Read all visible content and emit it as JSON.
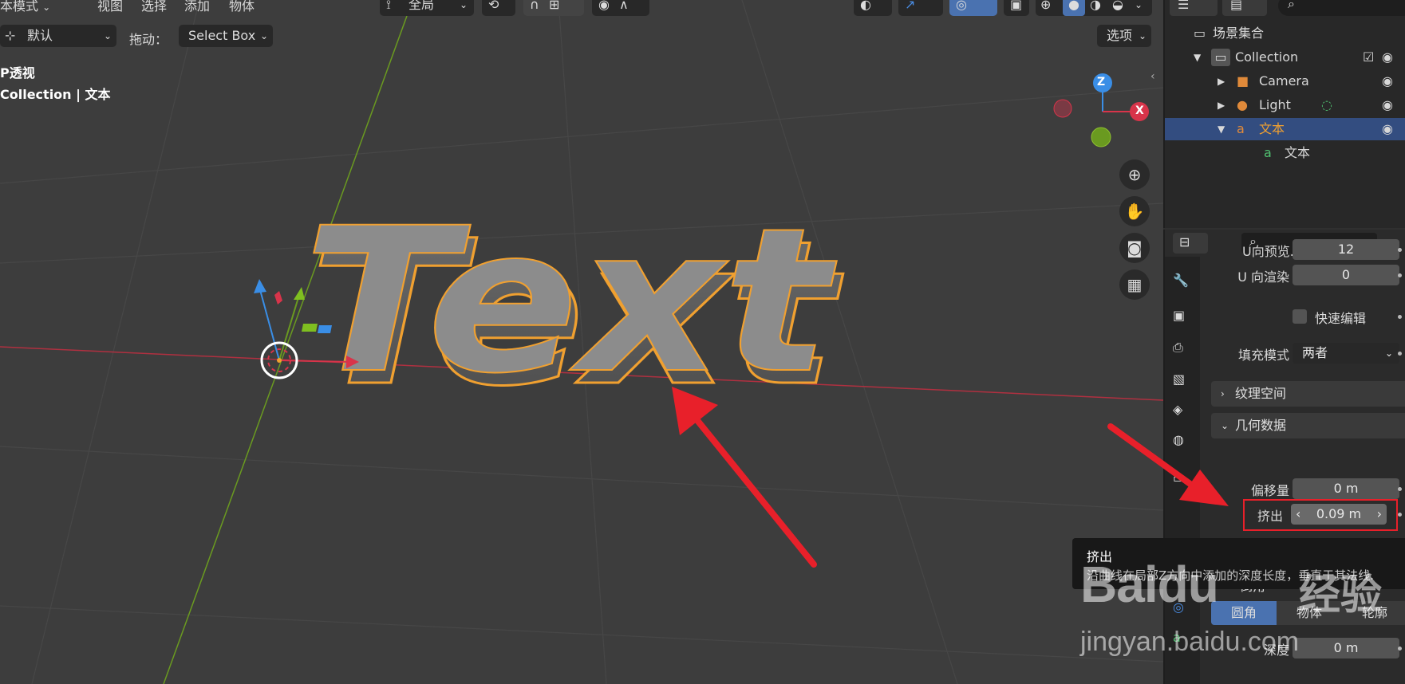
{
  "header": {
    "mode_label": "本模式",
    "menus": [
      "视图",
      "选择",
      "添加",
      "物体"
    ],
    "transform_orientation": "全局"
  },
  "toolbar": {
    "default_label": "默认",
    "drag_label": "拖动：",
    "select_box": "Select Box",
    "options_label": "选项"
  },
  "viewport": {
    "view_label": "P透视",
    "collection_label": "Collection | 文本",
    "text_object": "Text",
    "axes": {
      "z": "Z",
      "x": "X"
    }
  },
  "outliner": {
    "scene_collection": "场景集合",
    "collection": "Collection",
    "items": [
      {
        "label": "Camera"
      },
      {
        "label": "Light"
      },
      {
        "label": "文本"
      },
      {
        "label": "文本"
      }
    ]
  },
  "properties": {
    "u_preview_label": "U向预览...",
    "u_preview_value": "12",
    "u_render_label": "U 向渲染",
    "u_render_value": "0",
    "fast_edit_label": "快速编辑",
    "fill_mode_label": "填充模式",
    "fill_mode_value": "两者",
    "texture_space_label": "纹理空间",
    "geometry_label": "几何数据",
    "offset_label": "偏移量",
    "offset_value": "0 m",
    "extrude_label": "挤出",
    "extrude_value": "0.09 m",
    "bevel_label": "倒角",
    "bevel_round_label": "圆角",
    "bevel_object_label": "物体",
    "bevel_profile_label": "轮廓",
    "depth_label": "深度",
    "depth_value": "0 m"
  },
  "tooltip": {
    "title": "挤出",
    "description": "沿曲线在局部Z方向中添加的深度长度，垂直于其法线."
  },
  "watermark": {
    "brand": "Baidu",
    "brand_cn": "经验",
    "url": "jingyan.baidu.com"
  },
  "colors": {
    "selection_outline": "#f0a030",
    "annotation_red": "#e8202a",
    "selected_row": "#334d80",
    "x_axis": "#d8344a",
    "y_axis": "#7fbf20",
    "z_axis": "#3a8ee6"
  }
}
